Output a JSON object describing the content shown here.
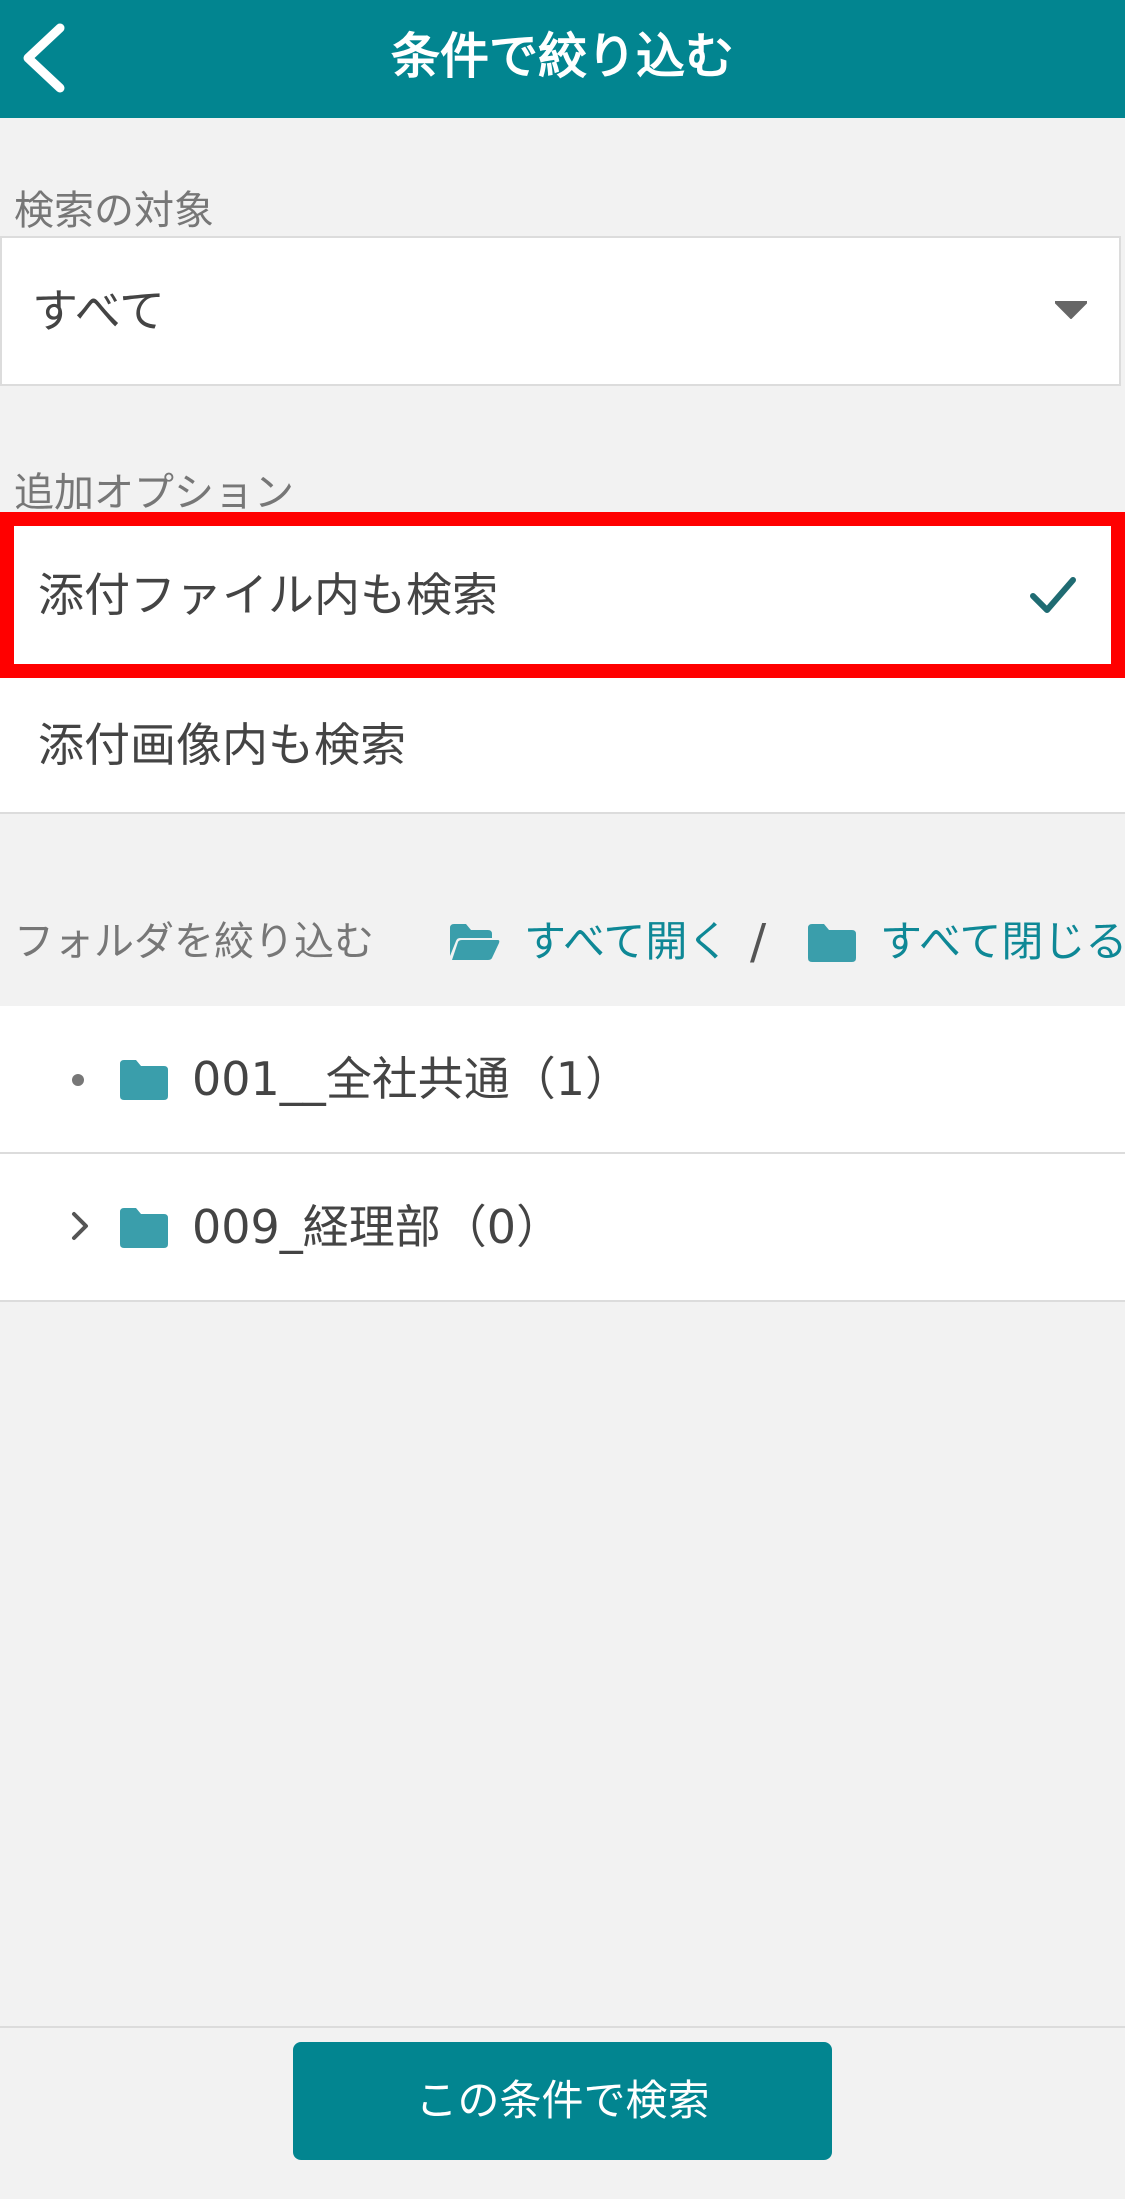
{
  "header": {
    "title": "条件で絞り込む",
    "back_icon": "chevron-left-icon"
  },
  "search_target": {
    "label": "検索の対象",
    "selected": "すべて"
  },
  "additional_options": {
    "label": "追加オプション",
    "items": [
      {
        "label": "添付ファイル内も検索",
        "checked": true
      },
      {
        "label": "添付画像内も検索",
        "checked": false
      }
    ]
  },
  "folder_filter": {
    "label": "フォルダを絞り込む",
    "expand_all": "すべて開く",
    "separator": "/",
    "collapse_all": "すべて閉じる",
    "folders": [
      {
        "label": "001__全社共通（1）",
        "expandable": false
      },
      {
        "label": "009_経理部（0）",
        "expandable": true
      }
    ]
  },
  "colors": {
    "primary": "#028590",
    "highlight": "#ff0000",
    "folder": "#3a9eab"
  },
  "footer": {
    "search_button": "この条件で検索"
  }
}
